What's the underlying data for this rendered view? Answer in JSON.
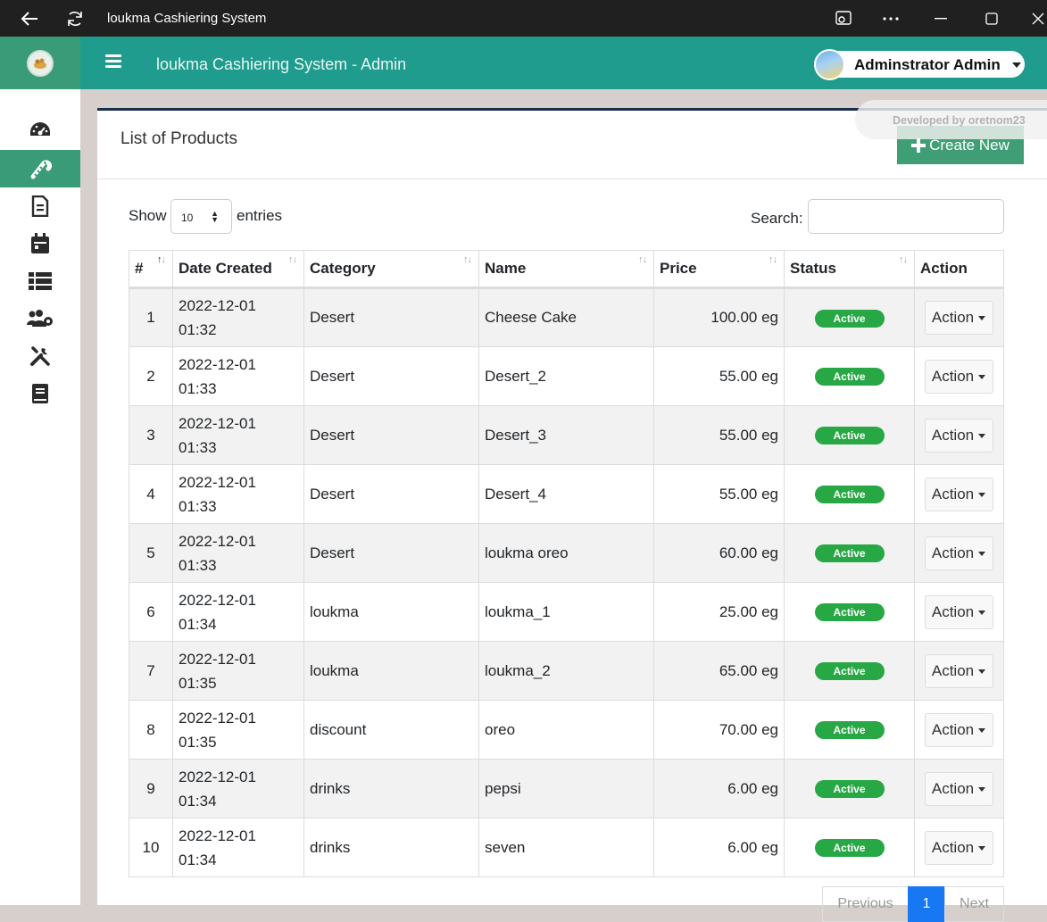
{
  "window": {
    "title": "loukma Cashiering System"
  },
  "header": {
    "title": "loukma Cashiering System - Admin",
    "user_name": "Adminstrator Admin"
  },
  "sidebar": {
    "items": [
      {
        "icon": "dashboard-icon",
        "active": false
      },
      {
        "icon": "candy-cane-icon",
        "active": true
      },
      {
        "icon": "file-invoice-icon",
        "active": false
      },
      {
        "icon": "calendar-icon",
        "active": false
      },
      {
        "icon": "list-icon",
        "active": false
      },
      {
        "icon": "users-cog-icon",
        "active": false
      },
      {
        "icon": "tools-icon",
        "active": false
      },
      {
        "icon": "book-icon",
        "active": false
      }
    ]
  },
  "page": {
    "title": "List of Products",
    "create_label": "Create New",
    "developer_badge": "Developed by oretnom23"
  },
  "table_controls": {
    "show_label": "Show",
    "entries_value": "10",
    "entries_label": "entries",
    "search_label": "Search:"
  },
  "table": {
    "headers": [
      "#",
      "Date Created",
      "Category",
      "Name",
      "Price",
      "Status",
      "Action"
    ],
    "rows": [
      {
        "num": "1",
        "date": "2022-12-01",
        "time": "01:32",
        "category": "Desert",
        "name": "Cheese Cake",
        "price": "100.00 eg",
        "status": "Active",
        "action": "Action"
      },
      {
        "num": "2",
        "date": "2022-12-01",
        "time": "01:33",
        "category": "Desert",
        "name": "Desert_2",
        "price": "55.00 eg",
        "status": "Active",
        "action": "Action"
      },
      {
        "num": "3",
        "date": "2022-12-01",
        "time": "01:33",
        "category": "Desert",
        "name": "Desert_3",
        "price": "55.00 eg",
        "status": "Active",
        "action": "Action"
      },
      {
        "num": "4",
        "date": "2022-12-01",
        "time": "01:33",
        "category": "Desert",
        "name": "Desert_4",
        "price": "55.00 eg",
        "status": "Active",
        "action": "Action"
      },
      {
        "num": "5",
        "date": "2022-12-01",
        "time": "01:33",
        "category": "Desert",
        "name": "loukma oreo",
        "price": "60.00 eg",
        "status": "Active",
        "action": "Action"
      },
      {
        "num": "6",
        "date": "2022-12-01",
        "time": "01:34",
        "category": "loukma",
        "name": "loukma_1",
        "price": "25.00 eg",
        "status": "Active",
        "action": "Action"
      },
      {
        "num": "7",
        "date": "2022-12-01",
        "time": "01:35",
        "category": "loukma",
        "name": "loukma_2",
        "price": "65.00 eg",
        "status": "Active",
        "action": "Action"
      },
      {
        "num": "8",
        "date": "2022-12-01",
        "time": "01:35",
        "category": "discount",
        "name": "oreo",
        "price": "70.00 eg",
        "status": "Active",
        "action": "Action"
      },
      {
        "num": "9",
        "date": "2022-12-01",
        "time": "01:34",
        "category": "drinks",
        "name": "pepsi",
        "price": "6.00 eg",
        "status": "Active",
        "action": "Action"
      },
      {
        "num": "10",
        "date": "2022-12-01",
        "time": "01:34",
        "category": "drinks",
        "name": "seven",
        "price": "6.00 eg",
        "status": "Active",
        "action": "Action"
      }
    ]
  },
  "pagination": {
    "previous": "Previous",
    "current": "1",
    "next": "Next"
  },
  "colors": {
    "sidebar_accent": "#3a9b78",
    "topbar": "#1f9c8e",
    "active_badge": "#28a745",
    "create_button": "#3f9e75"
  }
}
